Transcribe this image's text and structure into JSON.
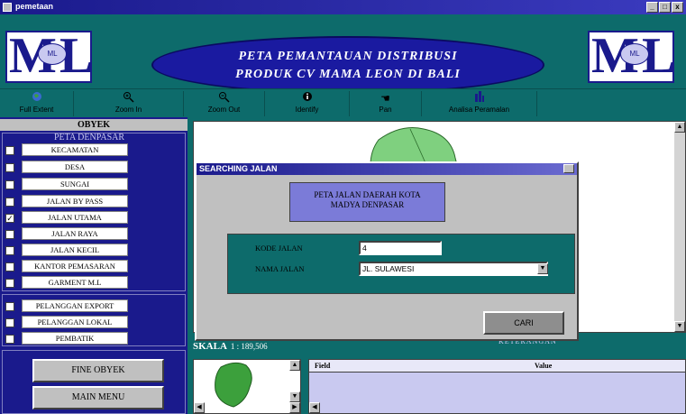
{
  "window": {
    "title": "pemetaan",
    "buttons": [
      "_",
      "□",
      "x"
    ]
  },
  "header": {
    "logo_letters": "ML",
    "logo_small": "ML",
    "banner_line1": "PETA PEMANTAUAN DISTRIBUSI",
    "banner_line2": "PRODUK CV MAMA LEON DI BALI"
  },
  "toolbar": [
    {
      "label": "Full Extent",
      "icon": "globe-icon"
    },
    {
      "label": "Zoom In",
      "icon": "zoom-in-icon"
    },
    {
      "label": "Zoom Out",
      "icon": "zoom-out-icon"
    },
    {
      "label": "Identify",
      "icon": "info-icon"
    },
    {
      "label": "Pan",
      "icon": "hand-icon"
    },
    {
      "label": "Analisa Peramalan",
      "icon": "chart-icon"
    }
  ],
  "left": {
    "title": "OBYEK",
    "group_label": "PETA DENPASAR",
    "layers": [
      {
        "label": "KECAMATAN",
        "checked": false
      },
      {
        "label": "DESA",
        "checked": false
      },
      {
        "label": "SUNGAI",
        "checked": false
      },
      {
        "label": "JALAN BY PASS",
        "checked": false
      },
      {
        "label": "JALAN UTAMA",
        "checked": true
      },
      {
        "label": "JALAN RAYA",
        "checked": false
      },
      {
        "label": "JALAN KECIL",
        "checked": false
      },
      {
        "label": "KANTOR PEMASARAN",
        "checked": false
      },
      {
        "label": "GARMENT M.L",
        "checked": false
      }
    ],
    "customers": [
      {
        "label": "PELANGGAN EXPORT",
        "checked": false
      },
      {
        "label": "PELANGGAN LOKAL",
        "checked": false
      },
      {
        "label": "PEMBATIK",
        "checked": false
      }
    ],
    "btn_find": "FINE OBYEK",
    "btn_menu": "MAIN MENU"
  },
  "scale": {
    "label": "SKALA",
    "value": "1 : 189,506"
  },
  "keterangan": "KETERANGAN",
  "grid": {
    "col1": "Field",
    "col2": "Value"
  },
  "dialog": {
    "title": "SEARCHING JALAN",
    "heading_line1": "PETA JALAN DAERAH KOTA",
    "heading_line2": "MADYA DENPASAR",
    "kode_label": "KODE JALAN",
    "kode_value": "4",
    "nama_label": "NAMA JALAN",
    "nama_value": "JL. SULAWESI",
    "cari_label": "CARI"
  },
  "colors": {
    "teal": "#0d6b6b",
    "navy": "#1a1a8c",
    "lavender": "#7b7bd8",
    "map_green": "#7fd07f"
  }
}
